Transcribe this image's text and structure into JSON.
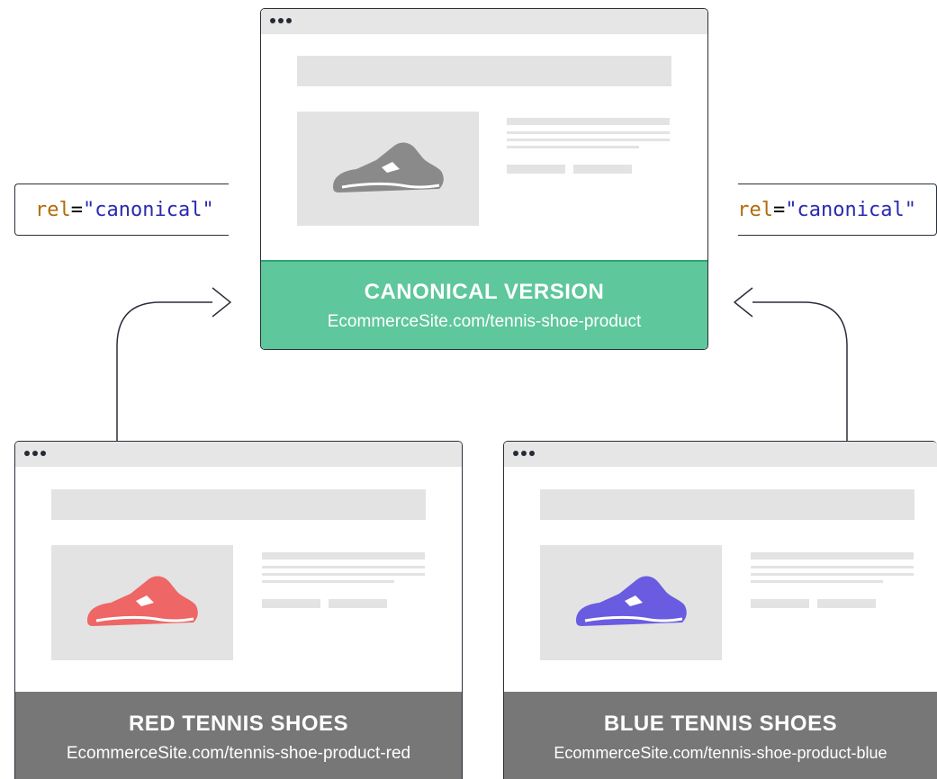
{
  "rel_tag": {
    "attr": "rel",
    "eq": "=",
    "value": "\"canonical\""
  },
  "canonical": {
    "title": "CANONICAL VERSION",
    "url": "EcommerceSite.com/tennis-shoe-product",
    "shoe_color": "#8a8a8a",
    "footer_color": "#5ec79b"
  },
  "red": {
    "title": "RED TENNIS SHOES",
    "url": "EcommerceSite.com/tennis-shoe-product-red",
    "shoe_color": "#ee6666",
    "footer_color": "#777777"
  },
  "blue": {
    "title": "BLUE TENNIS SHOES",
    "url": "EcommerceSite.com/tennis-shoe-product-blue",
    "shoe_color": "#6a5ce0",
    "footer_color": "#777777"
  },
  "icons": [
    "window-dots-icon",
    "shoe-icon",
    "arrow-icon"
  ]
}
